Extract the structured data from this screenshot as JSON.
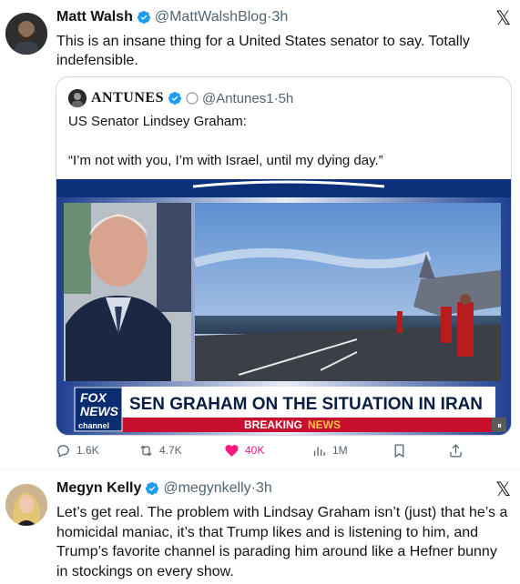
{
  "tweet1": {
    "author_name": "Matt Walsh",
    "handle": "@MattWalshBlog",
    "separator": "·",
    "time": "3h",
    "text": "This is an insane thing for a United States senator to say. Totally indefensible.",
    "quote": {
      "author_name": "ANTUNES",
      "handle": "@Antunes1",
      "separator": "·",
      "time": "5h",
      "line1": "US Senator Lindsey Graham:",
      "line2": "“I’m not with you, I’m with Israel, until my dying day.”",
      "media": {
        "logo_line1": "FOX",
        "logo_line2": "NEWS",
        "logo_line3": "channel",
        "headline": "SEN GRAHAM ON THE SITUATION IN IRAN",
        "ticker_prefix": "BREAKING",
        "ticker_suffix": "NEWS"
      }
    },
    "stats": {
      "replies": "1.6K",
      "reposts": "4.7K",
      "likes": "40K",
      "views": "1M"
    }
  },
  "tweet2": {
    "author_name": "Megyn Kelly",
    "handle": "@megynkelly",
    "separator": "·",
    "time": "3h",
    "text": "Let’s get real. The problem with Lindsay Graham isn’t (just) that he’s a homicidal maniac, it’s that Trump likes and is listening to him, and Trump’s favorite channel is parading him around like a Hefner bunny in stockings on every show."
  },
  "icons": {
    "x_logo": "𝕏",
    "verified": "verified-badge-icon"
  },
  "colors": {
    "verified_blue": "#1d9bf0",
    "like_pink": "#f91880",
    "secondary_text": "#536471"
  }
}
